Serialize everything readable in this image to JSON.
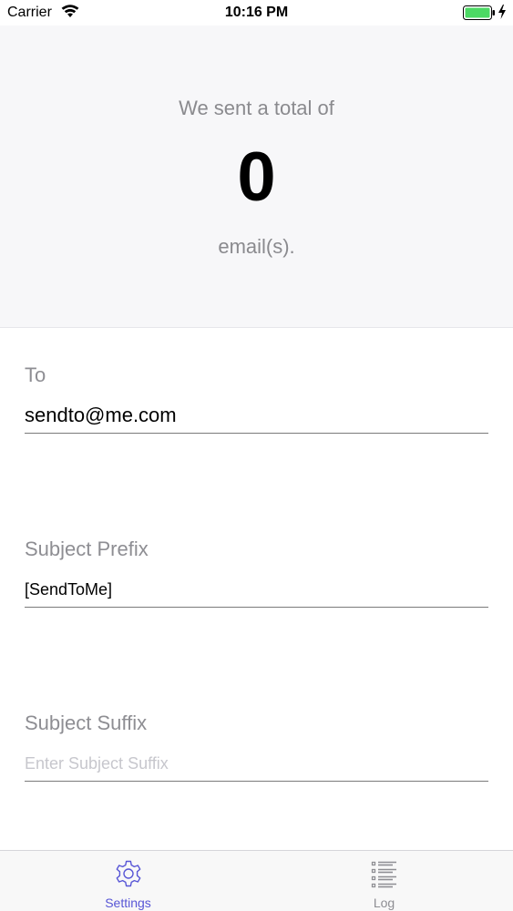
{
  "status_bar": {
    "carrier": "Carrier",
    "time": "10:16 PM",
    "wifi_icon": "wifi-icon",
    "battery_icon": "battery-full-icon",
    "charging_icon": "bolt-icon"
  },
  "summary": {
    "intro": "We sent a total of",
    "count": "0",
    "unit": "email(s)."
  },
  "form": {
    "to": {
      "label": "To",
      "value": "sendto@me.com",
      "placeholder": ""
    },
    "subject_prefix": {
      "label": "Subject Prefix",
      "value": "[SendToMe]",
      "placeholder": ""
    },
    "subject_suffix": {
      "label": "Subject Suffix",
      "value": "",
      "placeholder": "Enter Subject Suffix"
    }
  },
  "tab_bar": {
    "tabs": [
      {
        "label": "Settings",
        "icon": "gear-icon",
        "active": true
      },
      {
        "label": "Log",
        "icon": "list-icon",
        "active": false
      }
    ]
  },
  "colors": {
    "accent": "#5856d6",
    "header_background": "#f7f7f9",
    "muted_text": "#8e8e93",
    "battery_green": "#4cd964"
  }
}
